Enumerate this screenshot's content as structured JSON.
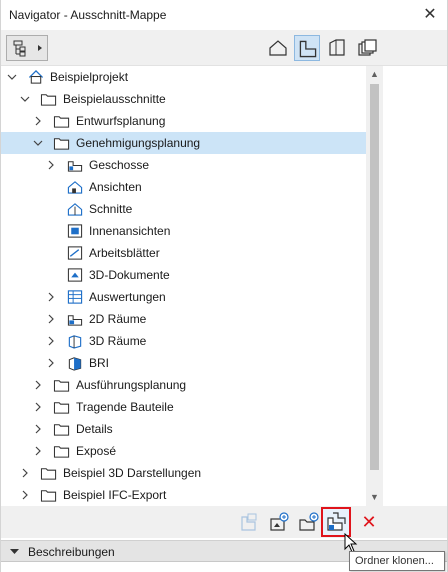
{
  "window": {
    "title": "Navigator - Ausschnitt-Mappe",
    "close_glyph": "✕"
  },
  "toolbar": {
    "buttons": [
      {
        "name": "project-map-icon",
        "active": false
      },
      {
        "name": "view-map-icon",
        "active": true
      },
      {
        "name": "layout-book-icon",
        "active": false
      },
      {
        "name": "publisher-sets-icon",
        "active": false
      }
    ]
  },
  "tree": {
    "items": [
      {
        "label": "Beispielprojekt",
        "depth": 0,
        "expanded": true,
        "icon": "project-icon"
      },
      {
        "label": "Beispielausschnitte",
        "depth": 1,
        "expanded": true,
        "icon": "folder-icon"
      },
      {
        "label": "Entwurfsplanung",
        "depth": 2,
        "expanded": false,
        "icon": "folder-icon"
      },
      {
        "label": "Genehmigungsplanung",
        "depth": 2,
        "expanded": true,
        "icon": "folder-icon",
        "selected": true
      },
      {
        "label": "Geschosse",
        "depth": 3,
        "expanded": false,
        "icon": "stories-icon"
      },
      {
        "label": "Ansichten",
        "depth": 3,
        "expanded": null,
        "icon": "elevation-icon"
      },
      {
        "label": "Schnitte",
        "depth": 3,
        "expanded": null,
        "icon": "section-icon"
      },
      {
        "label": "Innenansichten",
        "depth": 3,
        "expanded": null,
        "icon": "interior-elevation-icon"
      },
      {
        "label": "Arbeitsblätter",
        "depth": 3,
        "expanded": null,
        "icon": "worksheet-icon"
      },
      {
        "label": "3D-Dokumente",
        "depth": 3,
        "expanded": null,
        "icon": "3d-document-icon"
      },
      {
        "label": "Auswertungen",
        "depth": 3,
        "expanded": false,
        "icon": "schedule-icon"
      },
      {
        "label": "2D Räume",
        "depth": 3,
        "expanded": false,
        "icon": "2d-zones-icon"
      },
      {
        "label": "3D Räume",
        "depth": 3,
        "expanded": false,
        "icon": "3d-zones-icon"
      },
      {
        "label": "BRI",
        "depth": 3,
        "expanded": false,
        "icon": "volume-icon"
      },
      {
        "label": "Ausführungsplanung",
        "depth": 2,
        "expanded": false,
        "icon": "folder-icon"
      },
      {
        "label": "Tragende Bauteile",
        "depth": 2,
        "expanded": false,
        "icon": "folder-icon"
      },
      {
        "label": "Details",
        "depth": 2,
        "expanded": false,
        "icon": "folder-icon"
      },
      {
        "label": "Exposé",
        "depth": 2,
        "expanded": false,
        "icon": "folder-icon"
      },
      {
        "label": "Beispiel 3D Darstellungen",
        "depth": 1,
        "expanded": false,
        "icon": "folder-icon"
      },
      {
        "label": "Beispiel IFC-Export",
        "depth": 1,
        "expanded": false,
        "icon": "folder-icon"
      }
    ]
  },
  "actions": {
    "buttons": [
      {
        "name": "settings-view-icon",
        "enabled": false
      },
      {
        "name": "save-view-icon",
        "enabled": true
      },
      {
        "name": "new-folder-icon",
        "enabled": true
      },
      {
        "name": "clone-folder-icon",
        "enabled": true,
        "highlighted": true
      },
      {
        "name": "delete-icon",
        "enabled": true
      }
    ],
    "delete_glyph": "✕"
  },
  "details": {
    "section_label": "Beschreibungen"
  },
  "tooltip": {
    "text": "Ordner klonen..."
  },
  "colors": {
    "selection": "#cce4f7",
    "accent_blue": "#1e6fc8",
    "highlight_red": "#e0141b"
  }
}
